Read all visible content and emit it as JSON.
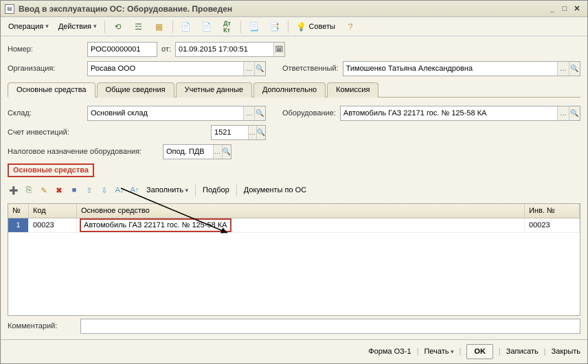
{
  "window": {
    "title": "Ввод в эксплуатацию ОС: Оборудование. Проведен"
  },
  "menu": {
    "operation": "Операция",
    "actions": "Действия",
    "advice": "Советы"
  },
  "fields": {
    "number_label": "Номер:",
    "number_value": "РОС00000001",
    "from_label": "от:",
    "date_value": "01.09.2015 17:00:51",
    "org_label": "Организация:",
    "org_value": "Росава ООО",
    "resp_label": "Ответственный:",
    "resp_value": "Тимошенко Татьяна Александровна",
    "warehouse_label": "Склад:",
    "warehouse_value": "Основний склад",
    "equip_label": "Оборудование:",
    "equip_value": "Автомобиль ГАЗ 22171 гос. № 125-58 КА",
    "invest_account_label": "Счет инвестиций:",
    "invest_account_value": "1521",
    "tax_purpose_label": "Налоговое назначение оборудования:",
    "tax_purpose_value": "Опод. ПДВ",
    "comment_label": "Комментарий:",
    "comment_value": ""
  },
  "tabs": {
    "t1": "Основные средства",
    "t2": "Общие сведения",
    "t3": "Учетные данные",
    "t4": "Дополнительно",
    "t5": "Комиссия"
  },
  "section": {
    "title": "Основные средства"
  },
  "grid_toolbar": {
    "fill": "Заполнить",
    "select": "Подбор",
    "docs": "Документы по ОС"
  },
  "grid": {
    "headers": {
      "num": "№",
      "code": "Код",
      "name": "Основное средство",
      "inv": "Инв. №"
    },
    "rows": [
      {
        "num": "1",
        "code": "00023",
        "name": "Автомобиль ГАЗ 22171 гос. № 125-58 КА",
        "inv": "00023"
      }
    ]
  },
  "footer": {
    "form": "Форма ОЗ-1",
    "print": "Печать",
    "ok": "OK",
    "save": "Записать",
    "close": "Закрыть"
  }
}
